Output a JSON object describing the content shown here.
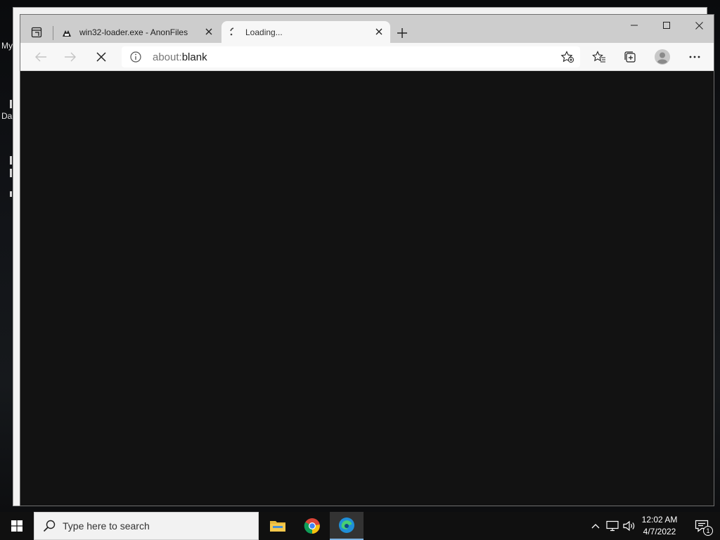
{
  "desktop": {
    "labels": [
      "My",
      "Da"
    ]
  },
  "browser": {
    "tabs": [
      {
        "title": "win32-loader.exe - AnonFiles",
        "icon": "anonfiles-favicon",
        "active": false
      },
      {
        "title": "Loading...",
        "icon": "loading-spinner-icon",
        "active": true
      }
    ],
    "address": {
      "scheme": "about:",
      "path": "blank"
    }
  },
  "taskbar": {
    "search_placeholder": "Type here to search",
    "apps": [
      "file-explorer",
      "google-chrome",
      "microsoft-edge"
    ],
    "clock": {
      "time": "12:02 AM",
      "date": "4/7/2022"
    },
    "notification_count": "1"
  },
  "colors": {
    "tabstrip": "#cdcdcd",
    "toolbar": "#f7f7f7",
    "content": "#121212",
    "taskbar": "#101010"
  }
}
